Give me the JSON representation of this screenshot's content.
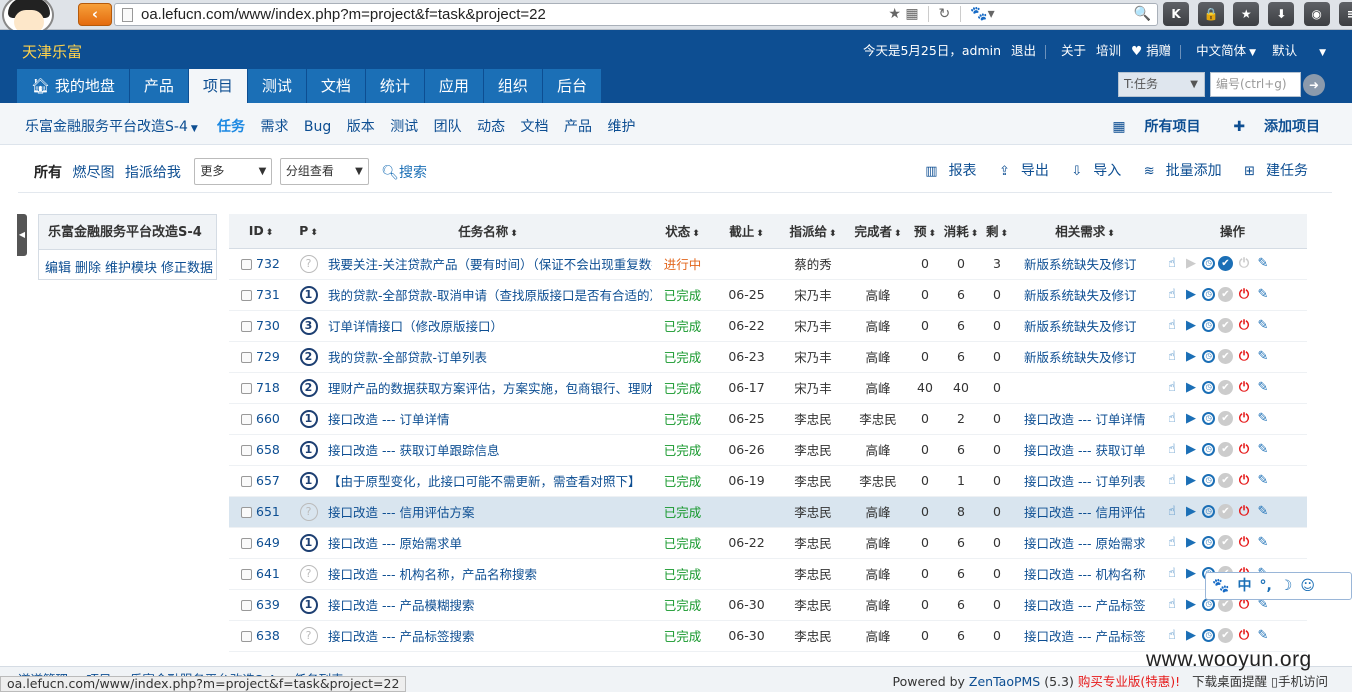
{
  "browser": {
    "url": "oa.lefucn.com/www/index.php?m=project&f=task&project=22",
    "status_url": "oa.lefucn.com/www/index.php?m=project&f=task&project=22"
  },
  "header": {
    "company": "天津乐富",
    "user_bar": {
      "greeting": "今天是5月25日，admin",
      "logout": "退出",
      "about": "关于",
      "training": "培训",
      "donate": "♥ 捐赠",
      "language": "中文简体",
      "theme": "默认"
    },
    "main_nav": [
      "我的地盘",
      "产品",
      "项目",
      "测试",
      "文档",
      "统计",
      "应用",
      "组织",
      "后台"
    ],
    "search_type": "T:任务",
    "id_placeholder": "编号(ctrl+g)"
  },
  "sub_nav": {
    "project": "乐富金融服务平台改造S-4",
    "links": [
      "任务",
      "需求",
      "Bug",
      "版本",
      "测试",
      "团队",
      "动态",
      "文档",
      "产品",
      "维护"
    ],
    "all_projects": "所有项目",
    "add_project": "添加项目"
  },
  "feature_bar": {
    "all": "所有",
    "burndown": "燃尽图",
    "assigned": "指派给我",
    "more": "更多",
    "group_view": "分组查看",
    "search": "搜索",
    "report": "报表",
    "export": "导出",
    "import": "导入",
    "batch_add": "批量添加",
    "create_task": "建任务"
  },
  "side_panel": {
    "title": "乐富金融服务平台改造S-4",
    "actions": [
      "编辑",
      "删除",
      "维护模块",
      "修正数据"
    ]
  },
  "task_table": {
    "headers": {
      "id": "ID",
      "pri": "P",
      "name": "任务名称",
      "status": "状态",
      "deadline": "截止",
      "assigned_to": "指派给",
      "finished_by": "完成者",
      "estimate": "预",
      "consumed": "消耗",
      "left": "剩",
      "story": "相关需求",
      "actions": "操作"
    },
    "rows": [
      {
        "id": "732",
        "pri": "?",
        "name": "我要关注-关注贷款产品（要有时间）（保证不会出现重复数据）",
        "status": "进行中",
        "deadline": "",
        "assigned": "蔡的秀",
        "finished": "",
        "est": "0",
        "con": "0",
        "left": "3",
        "story": "新版系统缺失及修订"
      },
      {
        "id": "731",
        "pri": "1",
        "name": "我的贷款-全部贷款-取消申请（查找原版接口是否有合适的）",
        "status": "已完成",
        "deadline": "06-25",
        "assigned": "宋乃丰",
        "finished": "高峰",
        "est": "0",
        "con": "6",
        "left": "0",
        "story": "新版系统缺失及修订"
      },
      {
        "id": "730",
        "pri": "3",
        "name": "订单详情接口（修改原版接口）",
        "status": "已完成",
        "deadline": "06-22",
        "assigned": "宋乃丰",
        "finished": "高峰",
        "est": "0",
        "con": "6",
        "left": "0",
        "story": "新版系统缺失及修订"
      },
      {
        "id": "729",
        "pri": "2",
        "name": "我的贷款-全部贷款-订单列表",
        "status": "已完成",
        "deadline": "06-23",
        "assigned": "宋乃丰",
        "finished": "高峰",
        "est": "0",
        "con": "6",
        "left": "0",
        "story": "新版系统缺失及修订"
      },
      {
        "id": "718",
        "pri": "2",
        "name": "理财产品的数据获取方案评估，方案实施，包商银行、理财",
        "status": "已完成",
        "deadline": "06-17",
        "assigned": "宋乃丰",
        "finished": "高峰",
        "est": "40",
        "con": "40",
        "left": "0",
        "story": ""
      },
      {
        "id": "660",
        "pri": "1",
        "name": "接口改造 --- 订单详情",
        "status": "已完成",
        "deadline": "06-25",
        "assigned": "李忠民",
        "finished": "李忠民",
        "est": "0",
        "con": "2",
        "left": "0",
        "story": "接口改造 --- 订单详情"
      },
      {
        "id": "658",
        "pri": "1",
        "name": "接口改造 --- 获取订单跟踪信息",
        "status": "已完成",
        "deadline": "06-26",
        "assigned": "李忠民",
        "finished": "高峰",
        "est": "0",
        "con": "6",
        "left": "0",
        "story": "接口改造 --- 获取订单"
      },
      {
        "id": "657",
        "pri": "1",
        "name": "【由于原型变化，此接口可能不需更新，需查看对照下】",
        "status": "已完成",
        "deadline": "06-19",
        "assigned": "李忠民",
        "finished": "李忠民",
        "est": "0",
        "con": "1",
        "left": "0",
        "story": "接口改造 --- 订单列表"
      },
      {
        "id": "651",
        "pri": "?",
        "name": "接口改造 --- 信用评估方案",
        "status": "已完成",
        "deadline": "",
        "assigned": "李忠民",
        "finished": "高峰",
        "est": "0",
        "con": "8",
        "left": "0",
        "story": "接口改造 --- 信用评估"
      },
      {
        "id": "649",
        "pri": "1",
        "name": "接口改造 --- 原始需求单",
        "status": "已完成",
        "deadline": "06-22",
        "assigned": "李忠民",
        "finished": "高峰",
        "est": "0",
        "con": "6",
        "left": "0",
        "story": "接口改造 --- 原始需求"
      },
      {
        "id": "641",
        "pri": "?",
        "name": "接口改造 --- 机构名称，产品名称搜索",
        "status": "已完成",
        "deadline": "",
        "assigned": "李忠民",
        "finished": "高峰",
        "est": "0",
        "con": "6",
        "left": "0",
        "story": "接口改造 --- 机构名称"
      },
      {
        "id": "639",
        "pri": "1",
        "name": "接口改造 --- 产品模糊搜索",
        "status": "已完成",
        "deadline": "06-30",
        "assigned": "李忠民",
        "finished": "高峰",
        "est": "0",
        "con": "6",
        "left": "0",
        "story": "接口改造 --- 产品标签"
      },
      {
        "id": "638",
        "pri": "?",
        "name": "接口改造 --- 产品标签搜索",
        "status": "已完成",
        "deadline": "06-30",
        "assigned": "李忠民",
        "finished": "高峰",
        "est": "0",
        "con": "6",
        "left": "0",
        "story": "接口改造 --- 产品标签"
      }
    ]
  },
  "footer": {
    "breadcrumb": "道道管理 > 项目 > 乐富金融服务平台改造S-4 > 任务列表",
    "powered": "Powered by",
    "zentao": "ZenTaoPMS",
    "version": "(5.3)",
    "buy": "购买专业版(特惠)!",
    "desktop": "下载桌面提醒",
    "mobile": "手机访问"
  },
  "watermark": "www.wooyun.org",
  "ime": [
    "中",
    "°,",
    "☽",
    "☺"
  ]
}
